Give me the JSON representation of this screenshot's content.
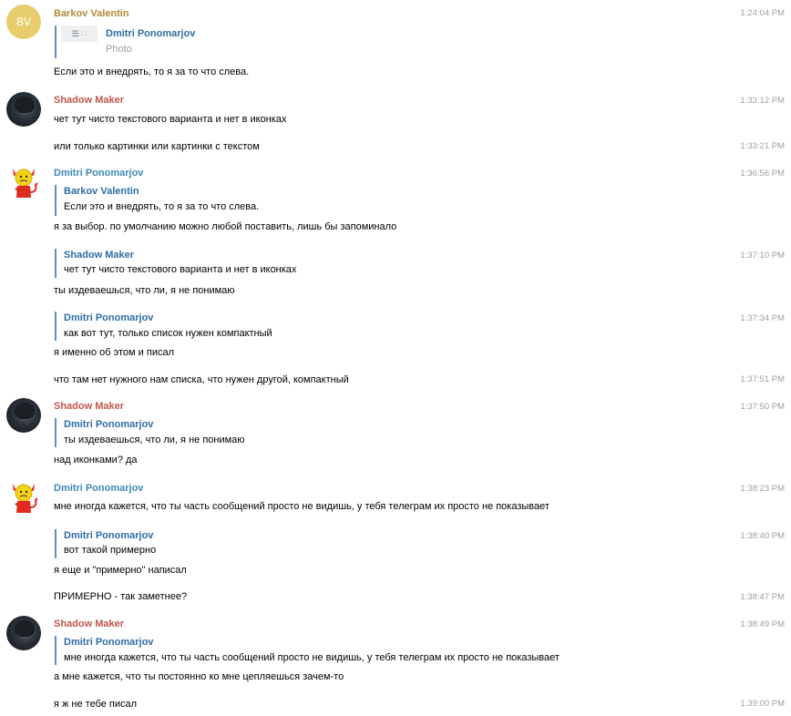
{
  "messages": {
    "m1": {
      "author": "Barkov Valentin",
      "avatar": "BV",
      "time": "1:24:04 PM",
      "reply": {
        "author": "Dmitri Ponomarjov",
        "text": "Photo"
      },
      "text": "Если это и внедрять, то я за то что слева."
    },
    "m2": {
      "author": "Shadow Maker",
      "time": "1:33:12 PM",
      "text": "чет тут чисто текстового варианта и нет в иконках"
    },
    "m3": {
      "time": "1:33:21 PM",
      "text": "или только картинки или картинки с текстом"
    },
    "m4": {
      "author": "Dmitri Ponomarjov",
      "time": "1:36:56 PM",
      "reply": {
        "author": "Barkov Valentin",
        "text": "Если это и внедрять, то я за то что слева."
      },
      "text": "я за выбор. по умолчанию можно любой поставить, лишь бы запоминало"
    },
    "m5": {
      "time": "1:37:10 PM",
      "reply": {
        "author": "Shadow Maker",
        "text": "чет тут чисто текстового варианта и нет в иконках"
      },
      "text": "ты издеваешься, что ли, я не понимаю"
    },
    "m6": {
      "time": "1:37:34 PM",
      "reply": {
        "author": "Dmitri Ponomarjov",
        "text": "как вот тут, только список нужен компактный"
      },
      "text": "я именно об этом и писал"
    },
    "m7": {
      "time": "1:37:51 PM",
      "text": "что там нет нужного нам списка, что нужен другой, компактный"
    },
    "m8": {
      "author": "Shadow Maker",
      "time": "1:37:50 PM",
      "reply": {
        "author": "Dmitri Ponomarjov",
        "text": "ты издеваешься, что ли, я не понимаю"
      },
      "text": "над иконками? да"
    },
    "m9": {
      "author": "Dmitri Ponomarjov",
      "time": "1:38:23 PM",
      "text": "мне иногда кажется, что ты часть сообщений просто не видишь, у тебя телеграм их просто не показывает"
    },
    "m10": {
      "time": "1:38:40 PM",
      "reply": {
        "author": "Dmitri Ponomarjov",
        "text": "вот такой примерно"
      },
      "text": "я еще и \"примерно\" написал"
    },
    "m11": {
      "time": "1:38:47 PM",
      "text": "ПРИМЕРНО - так заметнее?"
    },
    "m12": {
      "author": "Shadow Maker",
      "time": "1:38:49 PM",
      "reply": {
        "author": "Dmitri Ponomarjov",
        "text": "мне иногда кажется, что ты часть сообщений просто не видишь, у тебя телеграм их просто не показывает"
      },
      "text": "а мне кажется, что ты постоянно ко мне цепляешься зачем-то"
    },
    "m13": {
      "time": "1:39:00 PM",
      "text": "я ж не тебе писал"
    }
  },
  "colors": {
    "barkov": "#b08b3a",
    "shadow": "#c0574c",
    "dmitri": "#3d8ab5",
    "quote_bar": "#5f8fc4",
    "timestamp": "#9aa1a8"
  }
}
